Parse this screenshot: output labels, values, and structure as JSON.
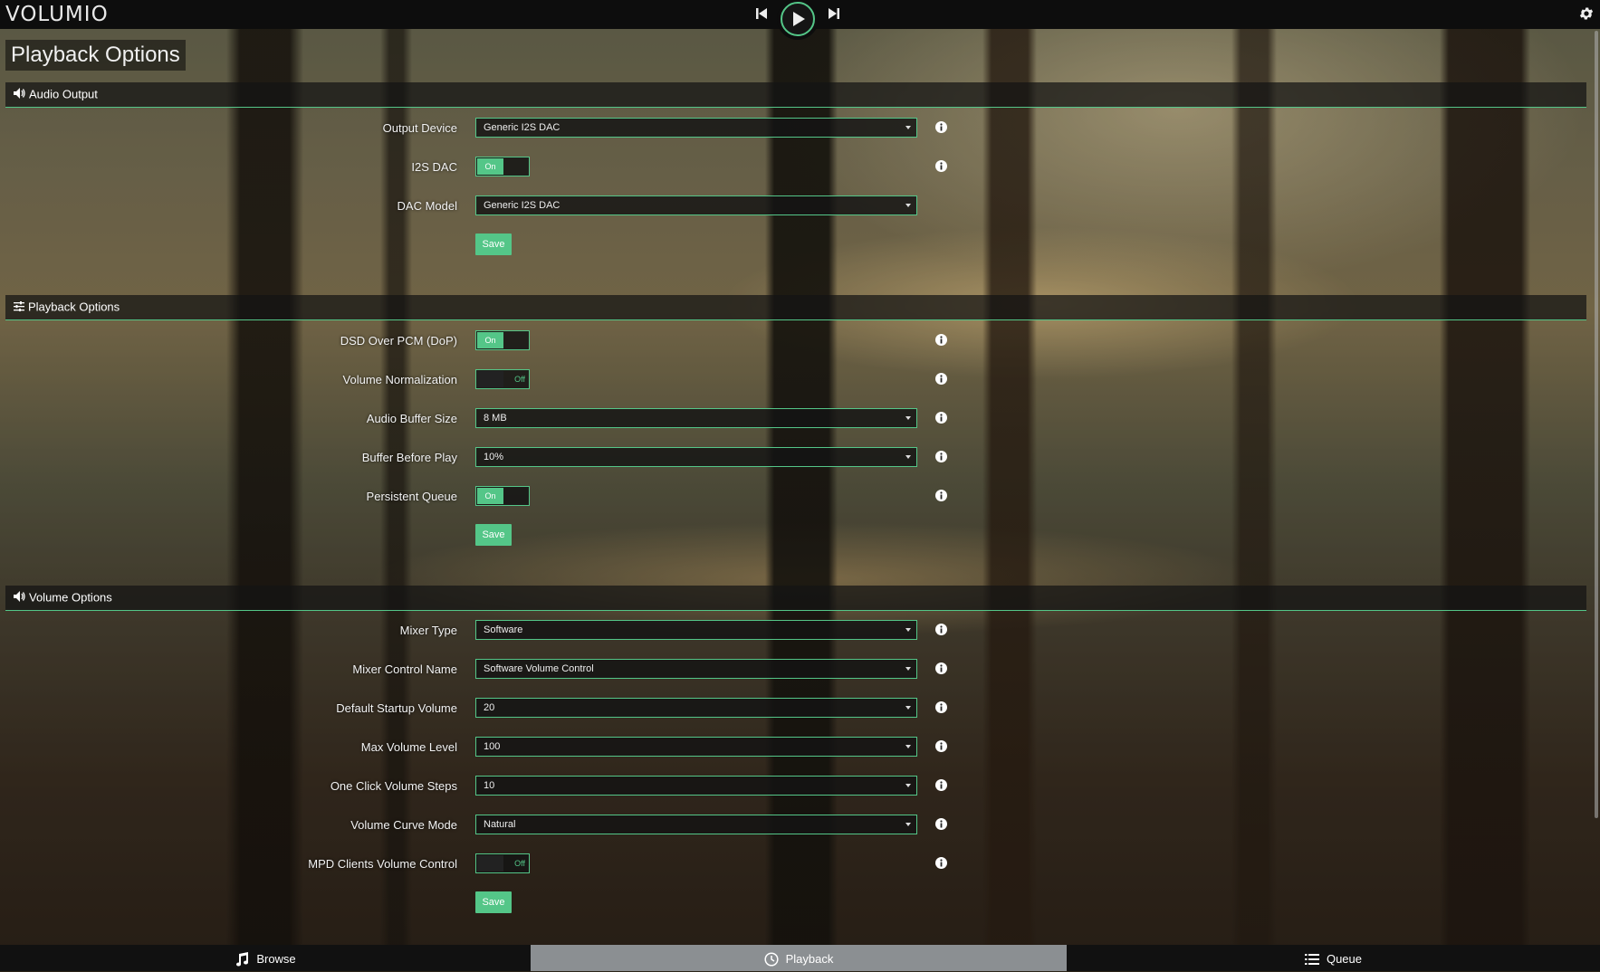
{
  "app": {
    "logo_text": "VOLUMIO",
    "accent_color": "#54c688"
  },
  "topbar": {
    "prev_icon": "skip-previous-icon",
    "play_icon": "play-icon",
    "next_icon": "skip-next-icon",
    "settings_icon": "gear-icon"
  },
  "page_title": "Playback Options",
  "sections": {
    "audio_output": {
      "title": "Audio Output",
      "icon": "speaker-icon",
      "output_device": {
        "label": "Output Device",
        "value": "Generic I2S DAC"
      },
      "i2s_dac": {
        "label": "I2S DAC",
        "state": "On"
      },
      "dac_model": {
        "label": "DAC Model",
        "value": "Generic I2S DAC"
      },
      "save_label": "Save"
    },
    "playback_options": {
      "title": "Playback Options",
      "icon": "sliders-icon",
      "dsd_over_pcm": {
        "label": "DSD Over PCM (DoP)",
        "state": "On"
      },
      "volume_normalization": {
        "label": "Volume Normalization",
        "state": "Off"
      },
      "audio_buffer_size": {
        "label": "Audio Buffer Size",
        "value": "8 MB"
      },
      "buffer_before_play": {
        "label": "Buffer Before Play",
        "value": "10%"
      },
      "persistent_queue": {
        "label": "Persistent Queue",
        "state": "On"
      },
      "save_label": "Save"
    },
    "volume_options": {
      "title": "Volume Options",
      "icon": "speaker-icon",
      "mixer_type": {
        "label": "Mixer Type",
        "value": "Software"
      },
      "mixer_control_name": {
        "label": "Mixer Control Name",
        "value": "Software Volume Control"
      },
      "default_startup_volume": {
        "label": "Default Startup Volume",
        "value": "20"
      },
      "max_volume_level": {
        "label": "Max Volume Level",
        "value": "100"
      },
      "one_click_volume_steps": {
        "label": "One Click Volume Steps",
        "value": "10"
      },
      "volume_curve_mode": {
        "label": "Volume Curve Mode",
        "value": "Natural"
      },
      "mpd_clients_volume_control": {
        "label": "MPD Clients Volume Control",
        "state": "Off"
      },
      "save_label": "Save"
    }
  },
  "bottom_nav": {
    "browse": {
      "label": "Browse",
      "icon": "music-note-icon"
    },
    "playback": {
      "label": "Playback",
      "icon": "clock-icon",
      "active": true
    },
    "queue": {
      "label": "Queue",
      "icon": "list-icon"
    }
  }
}
